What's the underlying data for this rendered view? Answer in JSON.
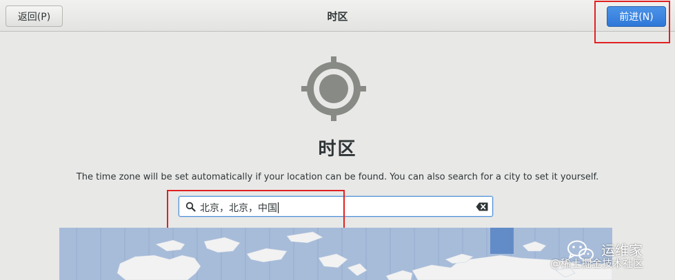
{
  "header": {
    "back_label": "返回(P)",
    "title": "时区",
    "next_label": "前进(N)"
  },
  "main": {
    "heading": "时区",
    "description": "The time zone will be set automatically if your location can be found. You can also search for a city to set it yourself.",
    "search": {
      "value": "北京，北京，中国"
    }
  },
  "watermark": {
    "name": "运维家",
    "sub": "@稀土掘金技术社区"
  },
  "icons": {
    "location": "location-crosshair-icon",
    "search": "search-icon",
    "clear": "clear-text-icon",
    "wechat": "wechat-logo"
  },
  "colors": {
    "accent": "#3584e4",
    "annotation": "#e02020",
    "map_ocean": "#a7bcd9",
    "map_land": "#f2f2f2",
    "map_selected_zone": "#5b86c4"
  }
}
